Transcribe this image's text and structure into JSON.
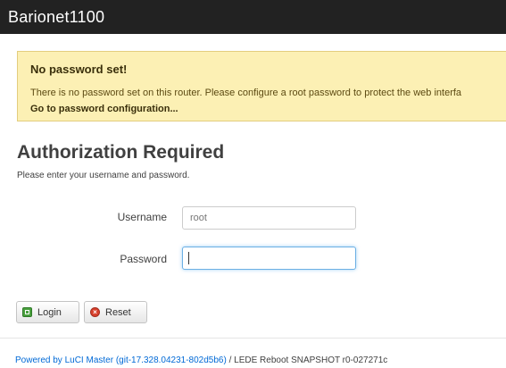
{
  "header": {
    "brand": "Barionet1100"
  },
  "alert": {
    "title": "No password set!",
    "text": "There is no password set on this router. Please configure a root password to protect the web interfa",
    "link": "Go to password configuration..."
  },
  "auth": {
    "title": "Authorization Required",
    "description": "Please enter your username and password.",
    "username_label": "Username",
    "username_value": "root",
    "password_label": "Password",
    "password_value": ""
  },
  "buttons": {
    "login": "Login",
    "reset": "Reset"
  },
  "footer": {
    "link_text": "Powered by LuCI Master (git-17.328.04231-802d5b6)",
    "rest_text": " / LEDE Reboot SNAPSHOT r0-027271c"
  },
  "colors": {
    "topbar": "#222222",
    "alert_bg": "#fcf0b4",
    "link": "#0069d6",
    "login_icon": "#4aa03f",
    "reset_icon": "#d8402c"
  },
  "icons": {
    "login": "login-icon",
    "reset": "reset-icon"
  }
}
